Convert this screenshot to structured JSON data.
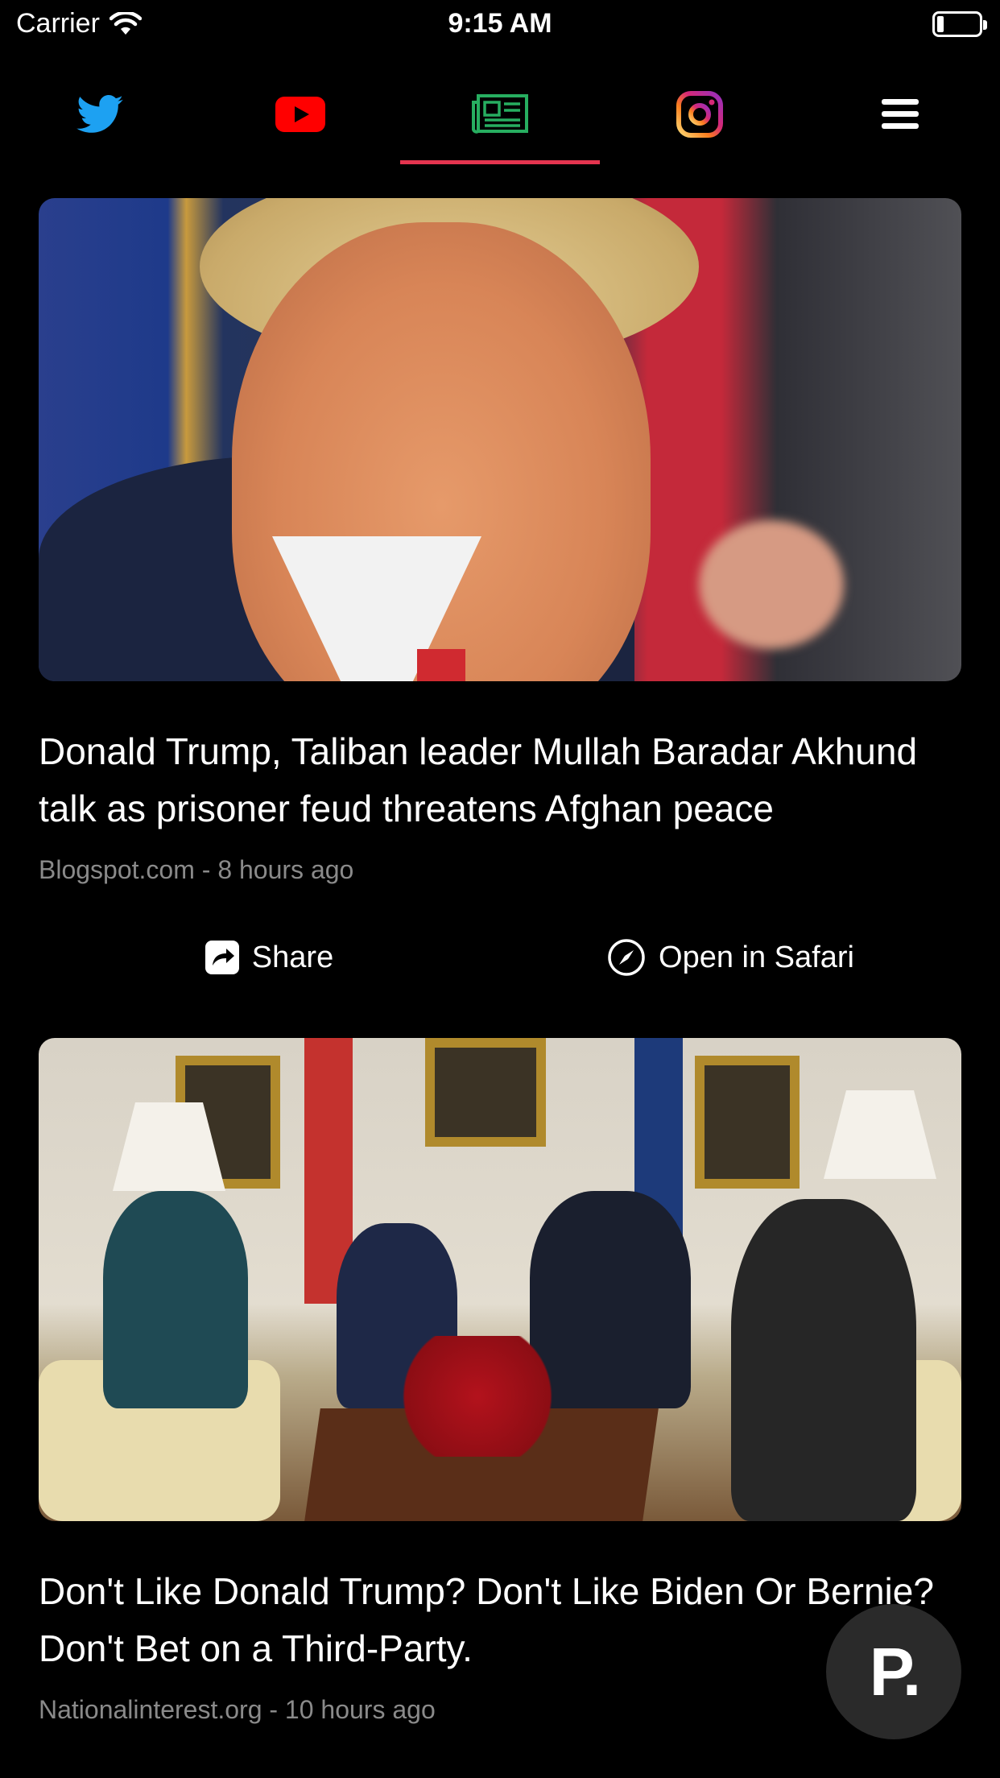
{
  "status_bar": {
    "carrier": "Carrier",
    "time": "9:15 AM"
  },
  "tabs": [
    {
      "name": "twitter-icon",
      "color": "#1da1f2",
      "active": false
    },
    {
      "name": "youtube-icon",
      "color": "#ff0000",
      "active": false
    },
    {
      "name": "news-icon",
      "color": "#27ae60",
      "active": true
    },
    {
      "name": "instagram-icon",
      "color": "#d6249f",
      "active": false
    },
    {
      "name": "menu-icon",
      "color": "#ffffff",
      "active": false
    }
  ],
  "accent_color": "#e4344f",
  "articles": [
    {
      "headline": "Donald Trump, Taliban leader Mullah Baradar Akhund talk as prisoner feud threatens Afghan peace",
      "meta": "Blogspot.com - 8 hours ago",
      "share_label": "Share",
      "safari_label": "Open in Safari"
    },
    {
      "headline": "Don't Like Donald Trump? Don't Like Biden Or Bernie? Don't Bet on a Third-Party.",
      "meta": "Nationalinterest.org - 10 hours ago"
    }
  ],
  "fab": {
    "label": "P."
  }
}
